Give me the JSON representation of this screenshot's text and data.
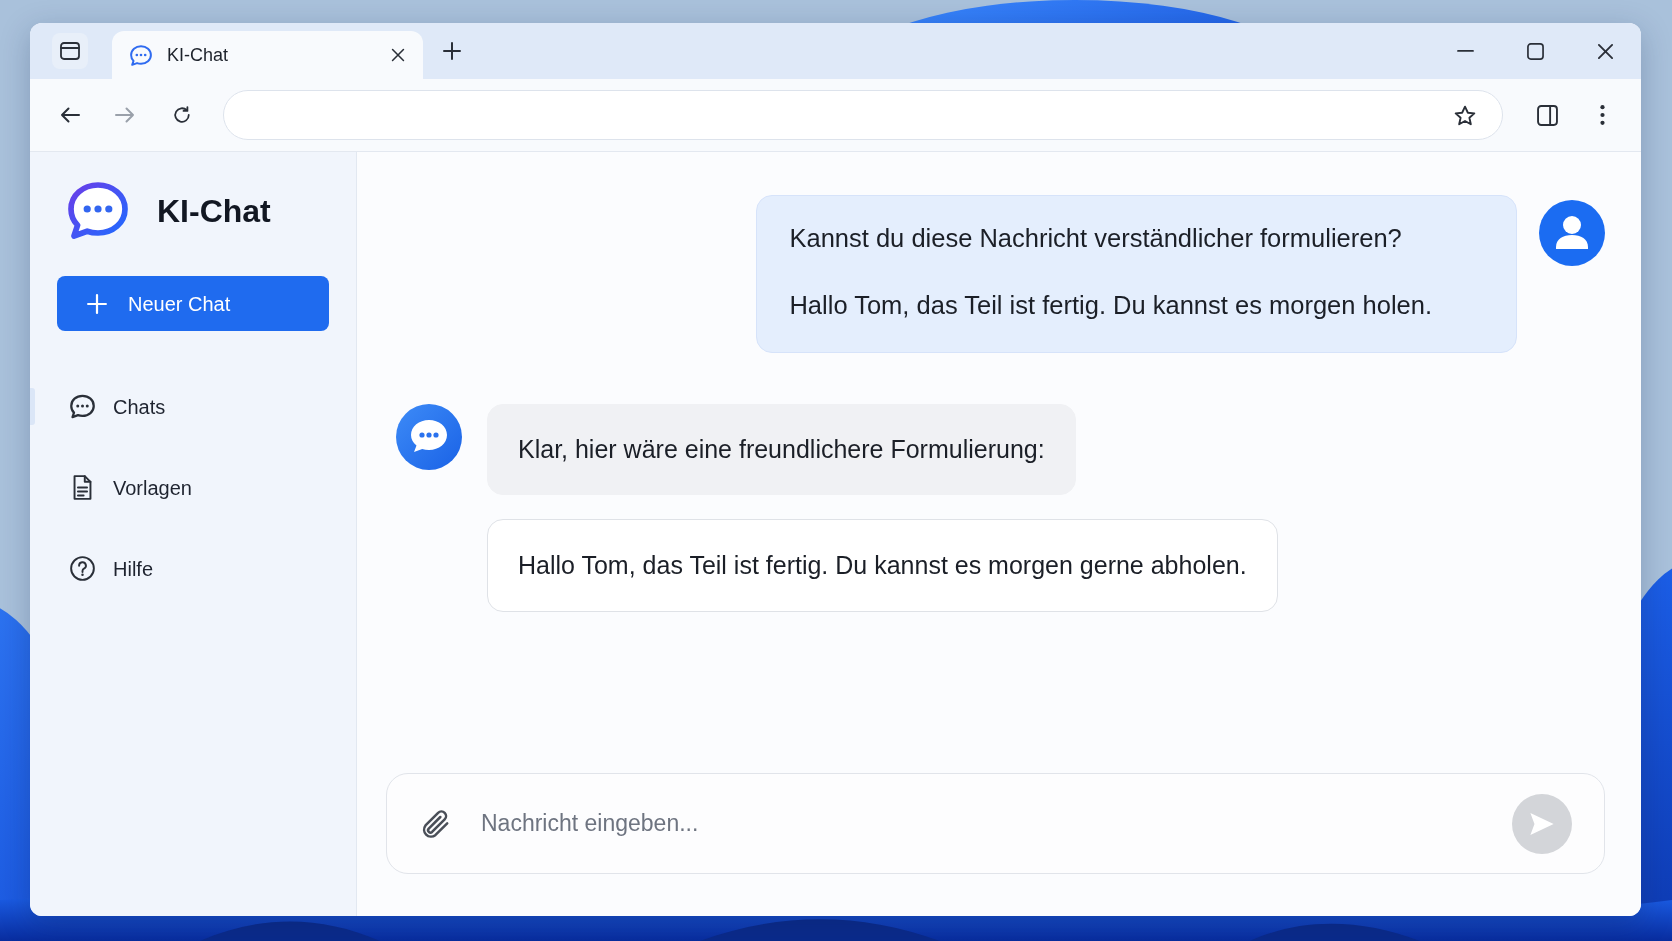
{
  "window": {
    "tabs": [
      {
        "title": "KI-Chat",
        "selected": true
      }
    ]
  },
  "toolbar": {
    "back": {
      "disabled": false
    },
    "forward": {
      "disabled": true
    }
  },
  "sidebar": {
    "title": "KI-Chat",
    "new_chat_button": "Neuer Chat",
    "items": [
      {
        "kind": "chats",
        "label": "Chats",
        "selected": true
      },
      {
        "kind": "templates",
        "label": "Vorlagen",
        "selected": false
      },
      {
        "kind": "help",
        "label": "Hilfe",
        "selected": false
      }
    ]
  },
  "chat": {
    "messages": [
      {
        "kind": "user",
        "paragraphs": [
          "Kannst du diese Nachricht verständlicher formulieren?",
          "Hallo Tom, das Teil ist fertig. Du kannst es morgen holen."
        ]
      },
      {
        "kind": "assistant",
        "bubbles": [
          {
            "kind": "reply",
            "text": "Klar, hier wäre eine freundlichere Formulierung:"
          },
          {
            "kind": "suggestion",
            "text": "Hallo Tom, das Teil ist fertig. Du kannst es morgen gerne abholen."
          }
        ]
      }
    ]
  },
  "composer": {
    "placeholder": "Nachricht eingeben...",
    "send_button": {
      "disabled": true
    }
  }
}
